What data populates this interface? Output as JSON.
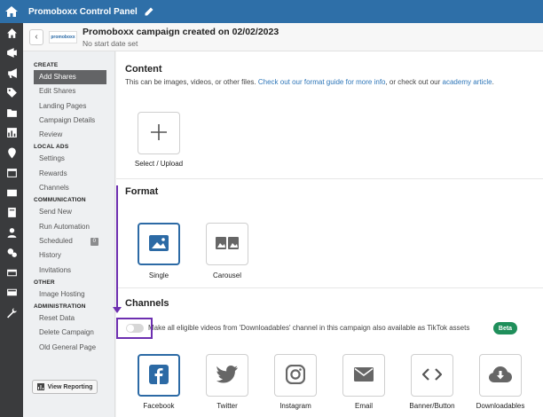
{
  "topbar": {
    "title": "Promoboxx Control Panel"
  },
  "header": {
    "campaign_title": "Promoboxx campaign created on 02/02/2023",
    "subtitle": "No start date set",
    "logo_text": "promoboxx"
  },
  "nav": {
    "create_label": "CREATE",
    "create_items": [
      "Add Shares",
      "Edit Shares",
      "Landing Pages",
      "Campaign Details",
      "Review"
    ],
    "local_ads_label": "LOCAL ADS",
    "local_ads_items": [
      "Settings",
      "Rewards",
      "Channels"
    ],
    "communication_label": "COMMUNICATION",
    "communication_items": [
      "Send New",
      "Run Automation",
      "Scheduled",
      "History",
      "Invitations"
    ],
    "scheduled_count": "0",
    "other_label": "OTHER",
    "other_items": [
      "Image Hosting"
    ],
    "administration_label": "ADMINISTRATION",
    "administration_items": [
      "Reset Data",
      "Delete Campaign",
      "Old General Page"
    ],
    "view_reporting": "View Reporting"
  },
  "content": {
    "title": "Content",
    "desc_prefix": "This can be images, videos, or other files.",
    "format_guide_link": "Check out our format guide for more info",
    "desc_middle": ", or check out our",
    "academy_link": "academy article",
    "desc_end": ".",
    "upload_label": "Select / Upload"
  },
  "format": {
    "title": "Format",
    "options": [
      "Single",
      "Carousel"
    ],
    "selected": "Single"
  },
  "channels": {
    "title": "Channels",
    "toggle_label": "Make all eligible videos from 'Downloadables' channel in this campaign also available as TikTok assets",
    "toggle_on": false,
    "beta_label": "Beta",
    "items": [
      "Facebook",
      "Twitter",
      "Instagram",
      "Email",
      "Banner/Button",
      "Downloadables"
    ],
    "selected": "Facebook"
  },
  "colors": {
    "topbar": "#2e6fa8",
    "rail": "#3a3b3d",
    "selected_border": "#2c6aa5",
    "link": "#2e76b8",
    "beta": "#1f8f5b",
    "annotation": "#6d2fb0"
  },
  "rail_icons": [
    "home-icon",
    "rocket-icon",
    "megaphone-icon",
    "tag-icon",
    "folder-icon",
    "bar-chart-icon",
    "map-pin-icon",
    "calendar-icon",
    "envelope-icon",
    "book-icon",
    "user-icon",
    "gears-icon",
    "credit-card-icon",
    "card-icon",
    "wrench-icon"
  ]
}
